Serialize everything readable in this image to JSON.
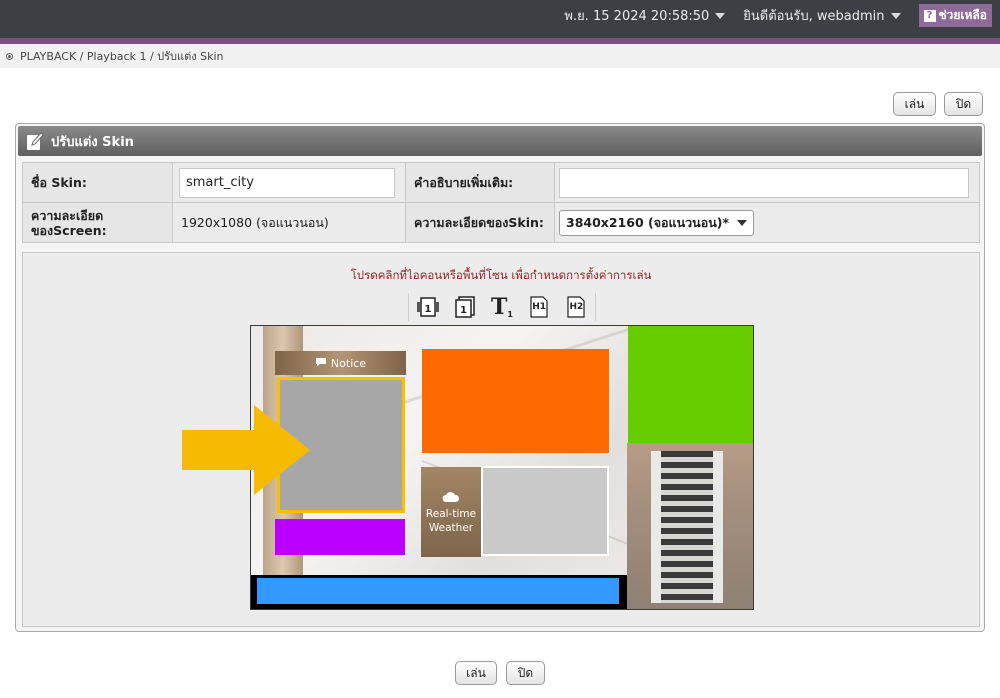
{
  "header": {
    "datetime": "พ.ย. 15 2024 20:58:50",
    "welcome": "ยินดีต้อนรับ, webadmin",
    "help_label": "ช่วยเหลือ",
    "help_icon": "?",
    "accent_color": "#7b4f86"
  },
  "breadcrumb": {
    "text": "PLAYBACK / Playback 1 / ปรับแต่ง Skin"
  },
  "actions": {
    "play_label": "เล่น",
    "close_label": "ปิด"
  },
  "panel": {
    "title": "ปรับแต่ง Skin",
    "fields": {
      "skin_name_label": "ชื่อ Skin:",
      "skin_name_value": "smart_city",
      "description_label": "คำอธิบายเพิ่มเติม:",
      "description_value": "",
      "screen_res_label_1": "ความละเอียด",
      "screen_res_label_2": "ของScreen:",
      "screen_res_value": "1920x1080 (จอแนวนอน)",
      "skin_res_label": "ความละเอียดของSkin:",
      "skin_res_value": "3840x2160 (จอแนวนอน)*"
    },
    "hint": "โปรดคลิกที่ไอคอนหรือพื้นที่โซน เพื่อกำหนดการตั้งค่าการเล่น",
    "tools": {
      "t_letter": "T",
      "t_sub": "1",
      "h1": "H1",
      "h2": "H2"
    },
    "preview": {
      "notice_label": "Notice",
      "weather_line1": "Real-time",
      "weather_line2": "Weather",
      "zone_colors": {
        "gray": "#a7a7a7",
        "orange": "#ff6a00",
        "green": "#66cc00",
        "purple": "#bb00ff",
        "blue": "#3399ff",
        "light_gray": "#c9c9c9",
        "selection": "#f6c100"
      }
    }
  }
}
